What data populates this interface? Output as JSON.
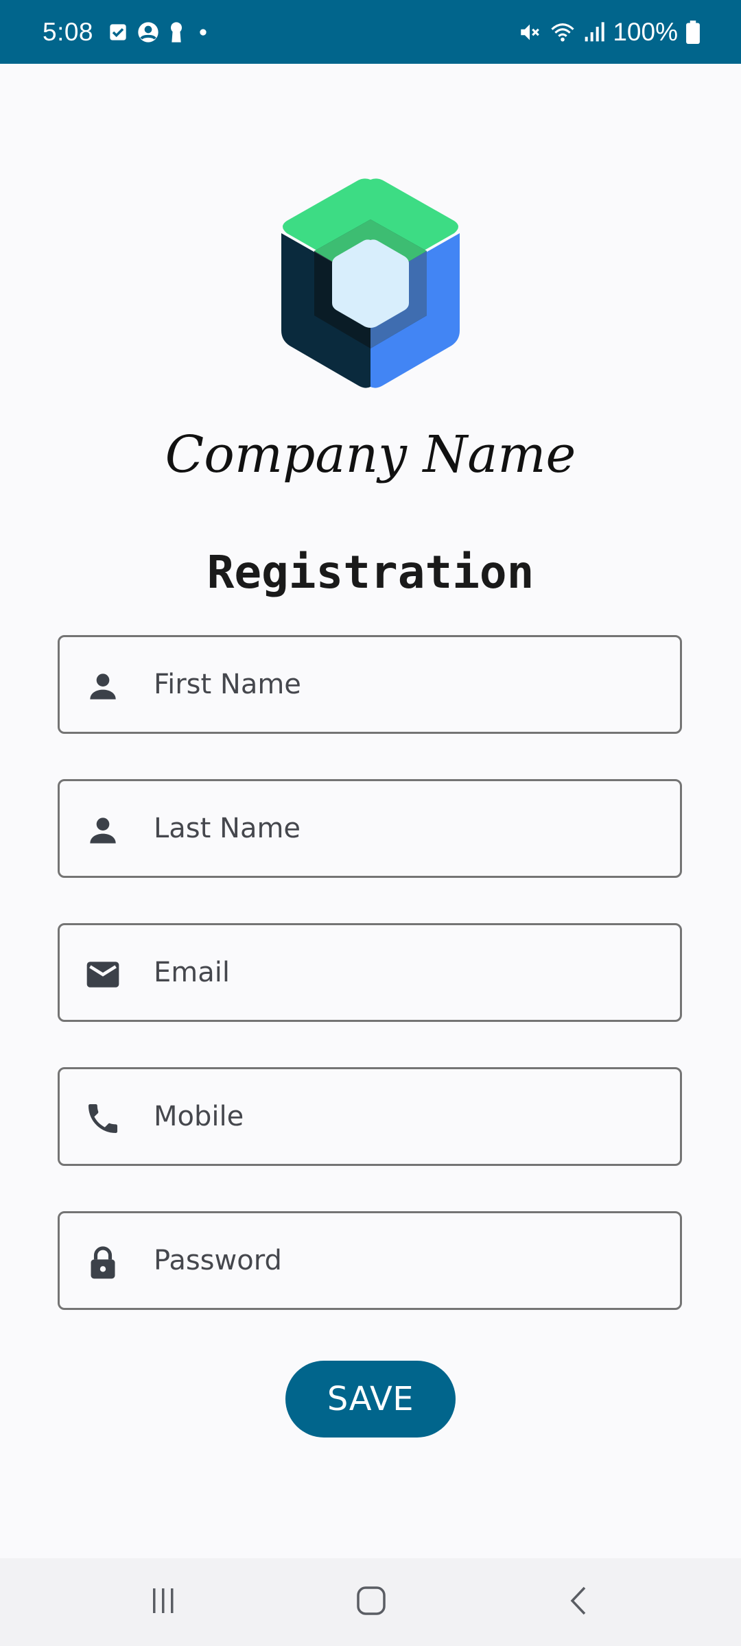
{
  "status_bar": {
    "time": "5:08",
    "battery": "100%",
    "icons_left": [
      "checkbox-icon",
      "account-circle-icon",
      "keyhole-icon",
      "dot-icon"
    ],
    "icons_right": [
      "mute-icon",
      "wifi-icon",
      "signal-icon",
      "battery-icon"
    ],
    "background_color": "#01658c"
  },
  "header": {
    "logo": "jetpack-compose-logo",
    "company_name": "Company Name",
    "title": "Registration"
  },
  "form": {
    "fields": [
      {
        "icon": "person-icon",
        "placeholder": "First Name",
        "value": ""
      },
      {
        "icon": "person-icon",
        "placeholder": "Last Name",
        "value": ""
      },
      {
        "icon": "email-icon",
        "placeholder": "Email",
        "value": ""
      },
      {
        "icon": "phone-icon",
        "placeholder": "Mobile",
        "value": ""
      },
      {
        "icon": "lock-icon",
        "placeholder": "Password",
        "value": ""
      }
    ],
    "save_label": "SAVE",
    "accent_color": "#01658c"
  },
  "nav_bar": {
    "buttons": [
      "recent-apps-icon",
      "home-icon",
      "back-icon"
    ]
  }
}
